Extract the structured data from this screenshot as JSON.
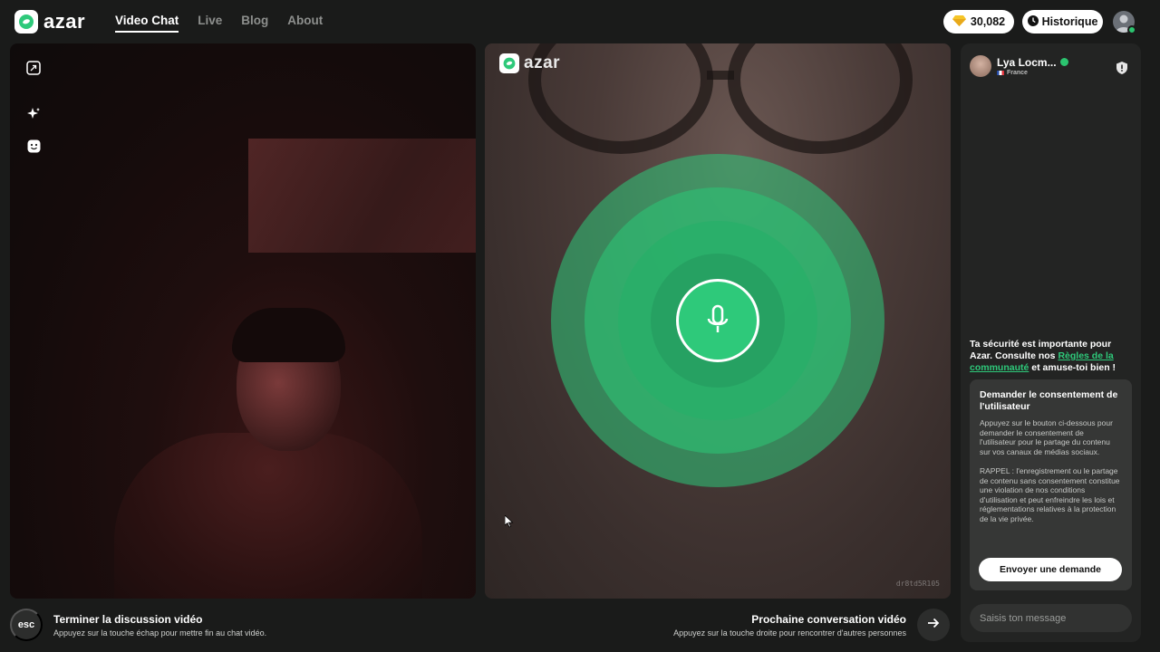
{
  "brand": {
    "name": "azar",
    "accent": "#2ec97a"
  },
  "nav": [
    {
      "label": "Video Chat",
      "active": true
    },
    {
      "label": "Live",
      "active": false
    },
    {
      "label": "Blog",
      "active": false
    },
    {
      "label": "About",
      "active": false
    }
  ],
  "header": {
    "gems": "30,082",
    "gem_icon": "diamond-icon",
    "history_label": "Historique",
    "history_icon": "clock-icon",
    "profile_icon": "user-icon"
  },
  "left_video": {
    "tools": [
      "collapse-icon",
      "sparkle-icon",
      "smile-icon"
    ]
  },
  "right_video": {
    "logo": "azar",
    "watermark": "dr8td5R105",
    "mic_icon": "microphone-icon"
  },
  "bottom": {
    "esc_label": "esc",
    "end_title": "Terminer la discussion vidéo",
    "end_sub": "Appuyez sur la touche échap pour mettre fin au chat vidéo.",
    "next_title": "Prochaine conversation vidéo",
    "next_sub": "Appuyez sur la touche droite pour rencontrer d'autres personnes",
    "next_icon": "arrow-right-icon"
  },
  "chat": {
    "partner_name": "Lya Locm...",
    "partner_country": "France",
    "safety_pre": "Ta sécurité est importante pour Azar. Consulte nos ",
    "safety_link": "Règles de la communauté",
    "safety_post": " et amuse-toi bien !",
    "consent_title": "Demander le consentement de l'utilisateur",
    "consent_p1": "Appuyez sur le bouton ci-dessous pour demander le consentement de l'utilisateur pour le partage du contenu sur vos canaux de médias sociaux.",
    "consent_p2": "RAPPEL : l'enregistrement ou le partage de contenu sans consentement constitue une violation de nos conditions d'utilisation et peut enfreindre les lois et réglementations relatives à la protection de la vie privée.",
    "consent_button": "Envoyer une demande",
    "input_placeholder": "Saisis ton message"
  }
}
